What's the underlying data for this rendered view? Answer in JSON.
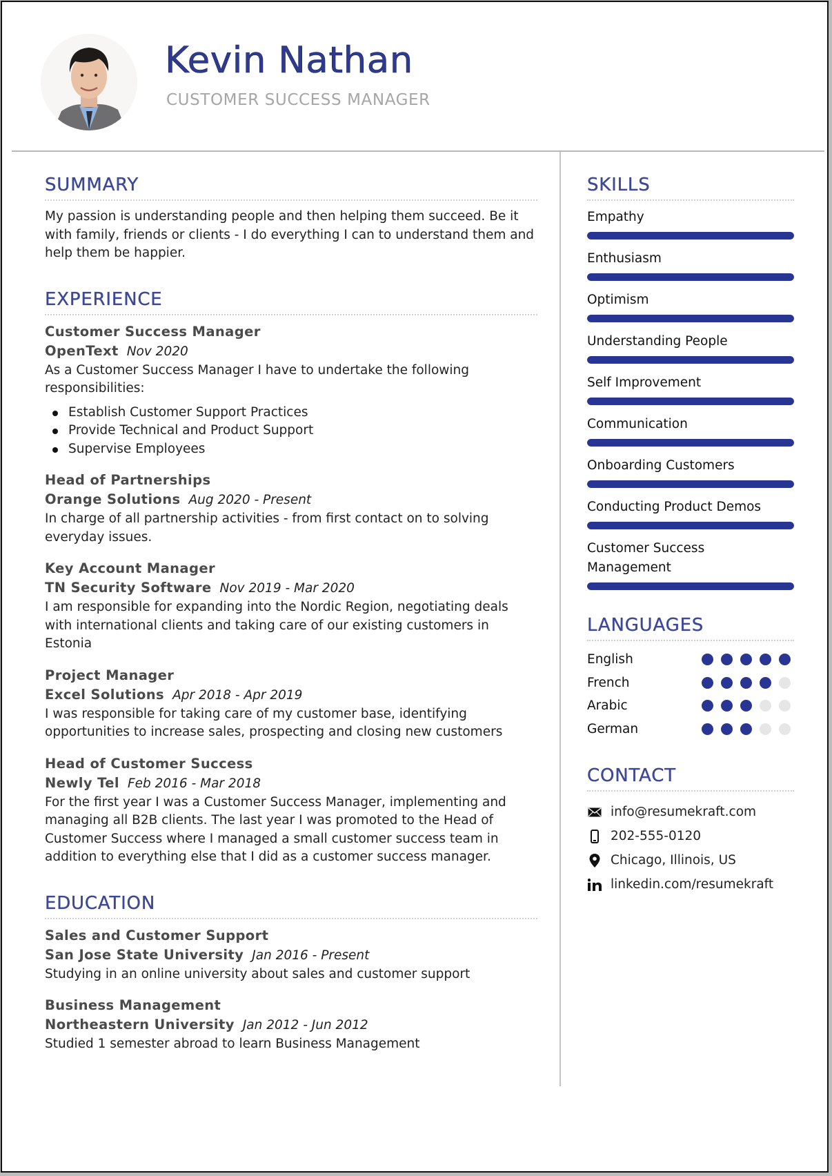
{
  "header": {
    "name": "Kevin Nathan",
    "role": "CUSTOMER SUCCESS MANAGER",
    "photo_icon": "profile-photo"
  },
  "summary": {
    "title": "SUMMARY",
    "text": "My passion is understanding people and then helping them succeed. Be it with family, friends or clients - I do everything I can to understand them and help them be happier."
  },
  "experience": {
    "title": "EXPERIENCE",
    "entries": [
      {
        "title": "Customer Success Manager",
        "org": "OpenText",
        "date": "Nov 2020",
        "description": "As a Customer Success Manager I have to undertake the following responsibilities:",
        "bullets": [
          "Establish Customer Support Practices",
          "Provide Technical and Product Support",
          "Supervise Employees"
        ]
      },
      {
        "title": "Head of Partnerships",
        "org": "Orange Solutions",
        "date": "Aug 2020 - Present",
        "description": "In charge of all partnership activities - from first contact on to solving everyday issues."
      },
      {
        "title": "Key Account Manager",
        "org": "TN Security Software",
        "date": "Nov 2019 - Mar 2020",
        "description": "I am responsible for expanding into the Nordic Region, negotiating deals with international clients and taking care of our existing customers in Estonia"
      },
      {
        "title": "Project Manager",
        "org": "Excel Solutions",
        "date": "Apr 2018 - Apr 2019",
        "description": "I was responsible for taking care of my customer base, identifying opportunities to increase sales, prospecting and closing new customers"
      },
      {
        "title": "Head of Customer Success",
        "org": "Newly Tel",
        "date": "Feb 2016 - Mar 2018",
        "description": "For the first year I was a Customer Success Manager, implementing and managing all B2B clients. The last year I was promoted to the Head of Customer Success where I managed a small customer success team in addition to everything else that I did as a customer success manager."
      }
    ]
  },
  "education": {
    "title": "EDUCATION",
    "entries": [
      {
        "title": "Sales and Customer Support",
        "org": "San Jose State University",
        "date": "Jan 2016 - Present",
        "description": "Studying in an online university about sales and customer support"
      },
      {
        "title": "Business Management",
        "org": "Northeastern University",
        "date": "Jan 2012 - Jun 2012",
        "description": "Studied 1 semester abroad to learn Business Management"
      }
    ]
  },
  "skills": {
    "title": "SKILLS",
    "accent": "#283593",
    "items": [
      {
        "label": "Empathy",
        "level": 1.0
      },
      {
        "label": "Enthusiasm",
        "level": 1.0
      },
      {
        "label": "Optimism",
        "level": 1.0
      },
      {
        "label": "Understanding People",
        "level": 1.0
      },
      {
        "label": "Self Improvement",
        "level": 1.0
      },
      {
        "label": "Communication",
        "level": 1.0
      },
      {
        "label": "Onboarding Customers",
        "level": 1.0
      },
      {
        "label": "Conducting Product Demos",
        "level": 1.0
      },
      {
        "label": "Customer Success Management",
        "level": 1.0
      }
    ]
  },
  "languages": {
    "title": "LANGUAGES",
    "max": 5,
    "items": [
      {
        "name": "English",
        "rating": 5
      },
      {
        "name": "French",
        "rating": 4
      },
      {
        "name": "Arabic",
        "rating": 3
      },
      {
        "name": "German",
        "rating": 3
      }
    ]
  },
  "contact": {
    "title": "CONTACT",
    "items": [
      {
        "icon": "envelope-icon",
        "text": "info@resumekraft.com"
      },
      {
        "icon": "phone-icon",
        "text": "202-555-0120"
      },
      {
        "icon": "map-pin-icon",
        "text": "Chicago, Illinois, US"
      },
      {
        "icon": "linkedin-icon",
        "text": "linkedin.com/resumekraft"
      }
    ]
  },
  "colors": {
    "accent": "#283593",
    "heading": "#3d4898",
    "muted": "#a6a6a6"
  }
}
